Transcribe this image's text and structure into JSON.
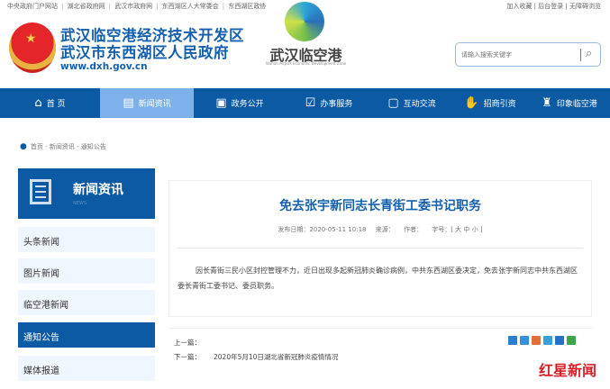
{
  "top_links": [
    "中央政府门户网站",
    "湖北省政府网",
    "武汉市政府网",
    "东西湖区人大常委会",
    "东西湖区政协"
  ],
  "right_links": "加入收藏 | 后台登录 | 无障碍浏览",
  "header": {
    "title1": "武汉临空港经济技术开发区",
    "title2": "武汉市东西湖区人民政府",
    "url": "www.dxh.gov.cn",
    "logo_text": "武汉临空港",
    "logo_sub": "Wuhan Airport Economic Development Zone"
  },
  "search": {
    "placeholder": "请输入搜索关键字"
  },
  "nav": [
    {
      "label": "首 页",
      "icon": "home-icon",
      "glyph": "⌂"
    },
    {
      "label": "新闻资讯",
      "icon": "news-icon",
      "glyph": "▤"
    },
    {
      "label": "政务公开",
      "icon": "document-icon",
      "glyph": "▣"
    },
    {
      "label": "办事服务",
      "icon": "monitor-icon",
      "glyph": "☑"
    },
    {
      "label": "互动交流",
      "icon": "chat-icon",
      "glyph": "▢"
    },
    {
      "label": "招商引资",
      "icon": "handshake-icon",
      "glyph": "✋"
    },
    {
      "label": "印象临空港",
      "icon": "building-icon",
      "glyph": "♜"
    }
  ],
  "breadcrumb": "首页 - 新闻资讯 - 通知公告",
  "sidebar": {
    "title": "新闻资讯",
    "title_en": "NEWS",
    "items": [
      "头条新闻",
      "图片新闻",
      "临空港新闻",
      "通知公告",
      "媒体报道"
    ],
    "active": 3
  },
  "article": {
    "title": "免去张宇新同志长青街工委书记职务",
    "date": "发布日期：2020-05-11 10:18",
    "source": "来源：",
    "author": "作者：",
    "font_size": "字号：[ 大  中  小 ]",
    "body": "因长青街三民小区封控管理不力，近日出现多起新冠肺炎确诊病例，中共东西湖区委决定，免去张宇新同志中共东西湖区委长青街工委书记、委员职务。"
  },
  "pager": {
    "prev_label": "上一篇：",
    "prev_title": "",
    "next_label": "下一篇：",
    "next_title": "2020年5月10日湖北省新冠肺炎疫情情况"
  },
  "share_colors": [
    "#2a7fd0",
    "#3a8fd8",
    "#e0703a",
    "#3aa0d8",
    "#2a6fc8",
    "#3aa84a"
  ],
  "watermark": "红星新闻"
}
